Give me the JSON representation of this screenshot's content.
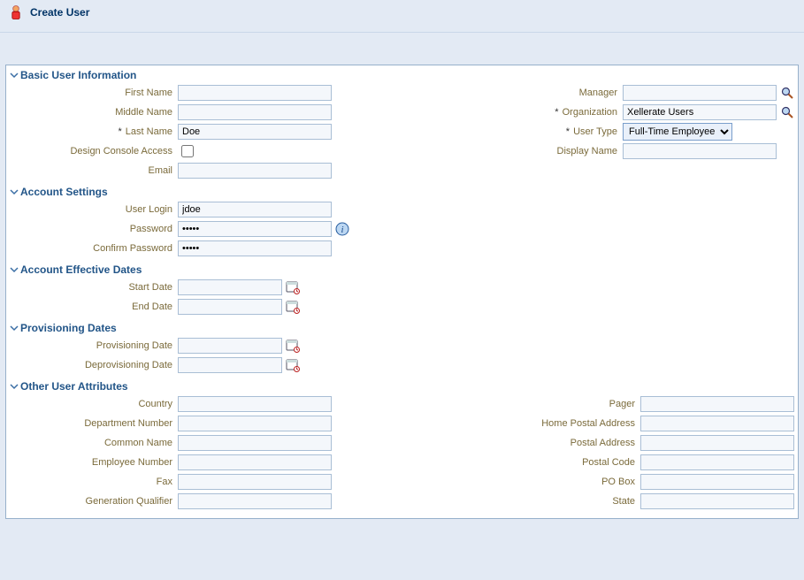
{
  "header": {
    "title": "Create User"
  },
  "sections": {
    "basic": {
      "title": "Basic User Information",
      "left": {
        "first_name": {
          "label": "First Name",
          "value": ""
        },
        "middle_name": {
          "label": "Middle Name",
          "value": ""
        },
        "last_name": {
          "label": "Last Name",
          "value": "Doe",
          "required": true
        },
        "design_console_access": {
          "label": "Design Console Access",
          "checked": false
        },
        "email": {
          "label": "Email",
          "value": ""
        }
      },
      "right": {
        "manager": {
          "label": "Manager",
          "value": ""
        },
        "organization": {
          "label": "Organization",
          "value": "Xellerate Users",
          "required": true
        },
        "user_type": {
          "label": "User Type",
          "value": "Full-Time Employee",
          "required": true
        },
        "display_name": {
          "label": "Display Name",
          "value": ""
        }
      }
    },
    "account": {
      "title": "Account Settings",
      "user_login": {
        "label": "User Login",
        "value": "jdoe"
      },
      "password": {
        "label": "Password",
        "value": "•••••"
      },
      "confirm_password": {
        "label": "Confirm Password",
        "value": "•••••"
      }
    },
    "effective": {
      "title": "Account Effective Dates",
      "start_date": {
        "label": "Start Date",
        "value": ""
      },
      "end_date": {
        "label": "End Date",
        "value": ""
      }
    },
    "provisioning": {
      "title": "Provisioning Dates",
      "provisioning_date": {
        "label": "Provisioning Date",
        "value": ""
      },
      "deprovisioning_date": {
        "label": "Deprovisioning Date",
        "value": ""
      }
    },
    "other": {
      "title": "Other User Attributes",
      "left": {
        "country": {
          "label": "Country",
          "value": ""
        },
        "department_number": {
          "label": "Department Number",
          "value": ""
        },
        "common_name": {
          "label": "Common Name",
          "value": ""
        },
        "employee_number": {
          "label": "Employee Number",
          "value": ""
        },
        "fax": {
          "label": "Fax",
          "value": ""
        },
        "generation_qualifier": {
          "label": "Generation Qualifier",
          "value": ""
        }
      },
      "right": {
        "pager": {
          "label": "Pager",
          "value": ""
        },
        "home_postal_address": {
          "label": "Home Postal Address",
          "value": ""
        },
        "postal_address": {
          "label": "Postal Address",
          "value": ""
        },
        "postal_code": {
          "label": "Postal Code",
          "value": ""
        },
        "po_box": {
          "label": "PO Box",
          "value": ""
        },
        "state": {
          "label": "State",
          "value": ""
        }
      }
    }
  }
}
